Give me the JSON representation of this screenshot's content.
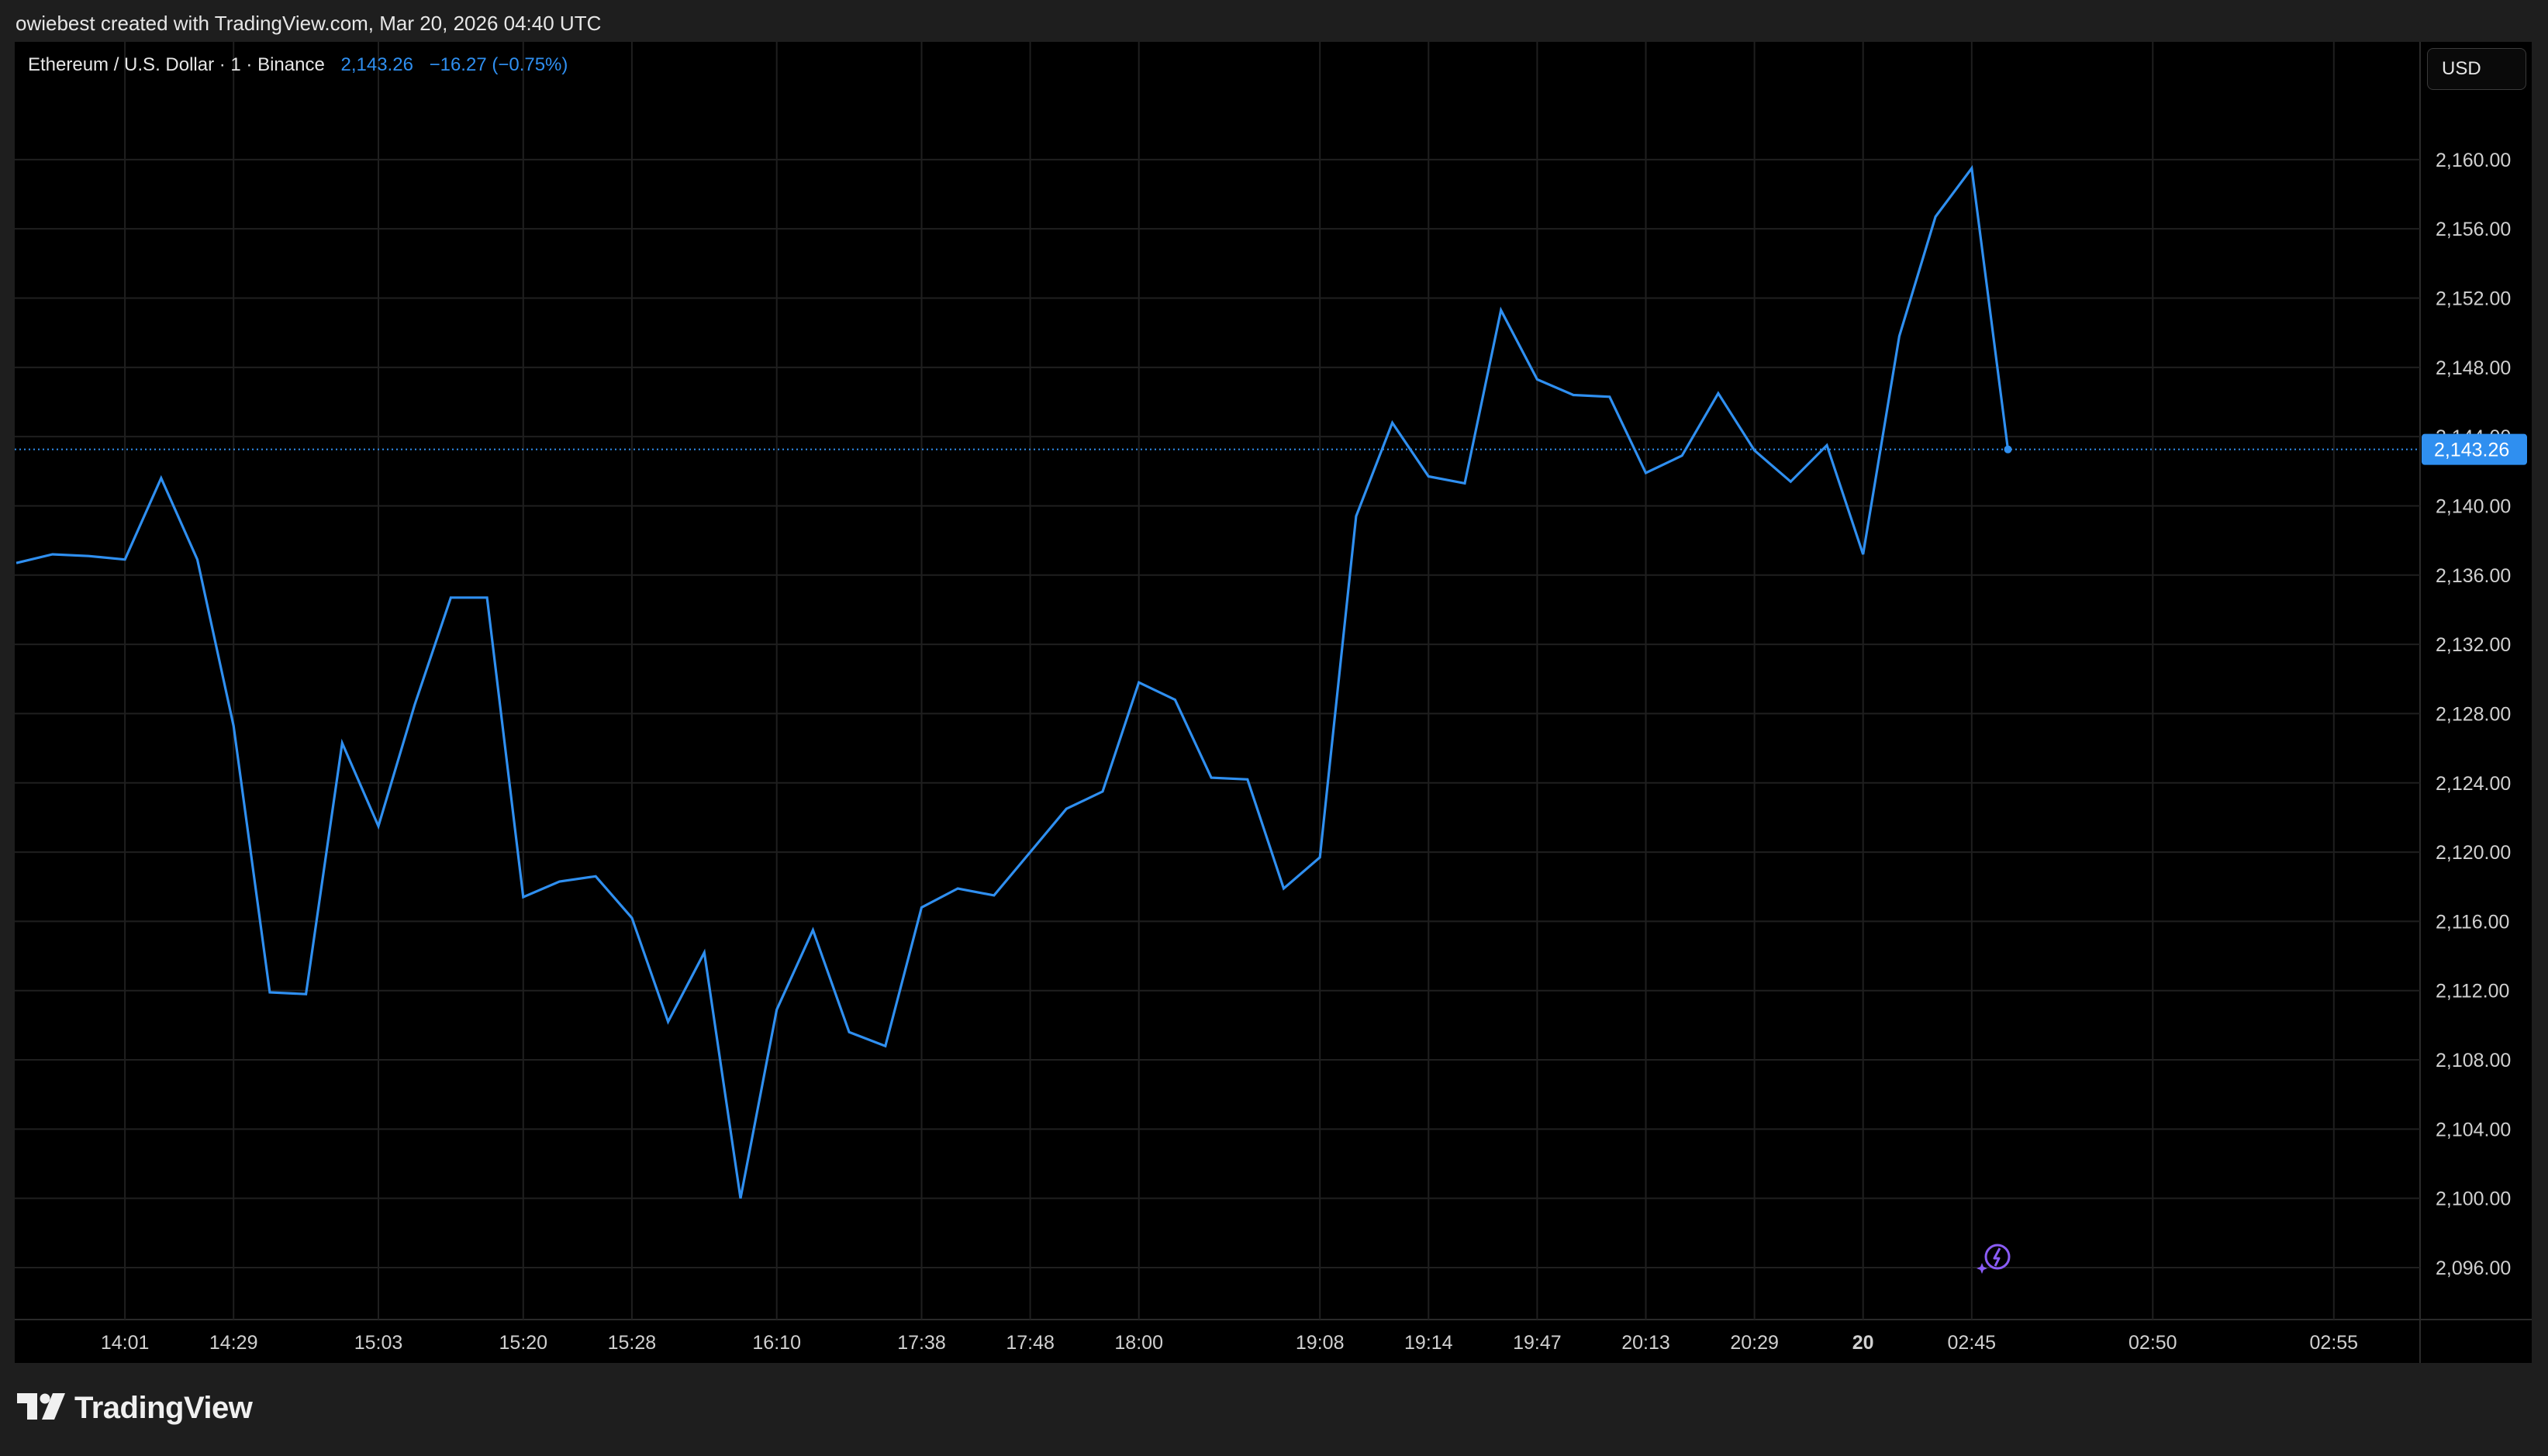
{
  "header": {
    "credit": "owiebest created with TradingView.com, Mar 20, 2026 04:40 UTC"
  },
  "legend": {
    "symbol": "Ethereum / U.S. Dollar · 1 · Binance",
    "price": "2,143.26",
    "change": "−16.27 (−0.75%)"
  },
  "currency_button": "USD",
  "last_price_label": "2,143.26",
  "footer": {
    "brand": "TradingView"
  },
  "colors": {
    "background": "#000000",
    "line": "#2f8ff0",
    "grid": "#1f1f1f",
    "axis_text": "#d0d0d0",
    "price_badge": "#2f8ff0"
  },
  "icons": [
    "tradingview-logo-icon",
    "replay-icon"
  ],
  "chart_data": {
    "type": "line",
    "title": "Ethereum / U.S. Dollar · 1 · Binance",
    "xlabel": "",
    "ylabel": "",
    "ylim": [
      2093,
      2166.8
    ],
    "y_ticks": [
      "2,096.00",
      "2,100.00",
      "2,104.00",
      "2,108.00",
      "2,112.00",
      "2,116.00",
      "2,120.00",
      "2,124.00",
      "2,128.00",
      "2,132.00",
      "2,136.00",
      "2,140.00",
      "2,144.00",
      "2,148.00",
      "2,152.00",
      "2,156.00",
      "2,160.00"
    ],
    "x_ticks": [
      {
        "label": "14:01",
        "index": 3,
        "bold": false
      },
      {
        "label": "14:29",
        "index": 6,
        "bold": false
      },
      {
        "label": "15:03",
        "index": 10,
        "bold": false
      },
      {
        "label": "15:20",
        "index": 14,
        "bold": false
      },
      {
        "label": "15:28",
        "index": 17,
        "bold": false
      },
      {
        "label": "16:10",
        "index": 21,
        "bold": false
      },
      {
        "label": "17:38",
        "index": 25,
        "bold": false
      },
      {
        "label": "17:48",
        "index": 28,
        "bold": false
      },
      {
        "label": "18:00",
        "index": 31,
        "bold": false
      },
      {
        "label": "19:08",
        "index": 36,
        "bold": false
      },
      {
        "label": "19:14",
        "index": 39,
        "bold": false
      },
      {
        "label": "19:47",
        "index": 42,
        "bold": false
      },
      {
        "label": "20:13",
        "index": 45,
        "bold": false
      },
      {
        "label": "20:29",
        "index": 48,
        "bold": false
      },
      {
        "label": "20",
        "index": 51,
        "bold": true
      },
      {
        "label": "02:45",
        "index": 54,
        "bold": false
      },
      {
        "label": "02:50",
        "index": 59,
        "bold": false
      },
      {
        "label": "02:55",
        "index": 64,
        "bold": false
      }
    ],
    "series": [
      {
        "values": [
          2136.7,
          2137.2,
          2137.1,
          2136.9,
          2141.6,
          2136.9,
          2127.3,
          2111.9,
          2111.8,
          2126.3,
          2121.5,
          2128.5,
          2134.7,
          2134.7,
          2117.4,
          2118.3,
          2118.6,
          2116.2,
          2110.2,
          2114.2,
          2100.0,
          2110.9,
          2115.5,
          2109.6,
          2108.8,
          2116.8,
          2117.9,
          2117.5,
          2120.0,
          2122.5,
          2123.5,
          2129.8,
          2128.8,
          2124.3,
          2124.2,
          2117.9,
          2119.7,
          2139.4,
          2144.8,
          2141.7,
          2141.3,
          2151.3,
          2147.3,
          2146.4,
          2146.3,
          2141.9,
          2142.9,
          2146.5,
          2143.2,
          2141.4,
          2143.5,
          2137.2,
          2149.8,
          2156.7,
          2159.5,
          2143.26
        ]
      }
    ],
    "last_value": 2143.26,
    "grid": true,
    "legend": "top-left"
  }
}
